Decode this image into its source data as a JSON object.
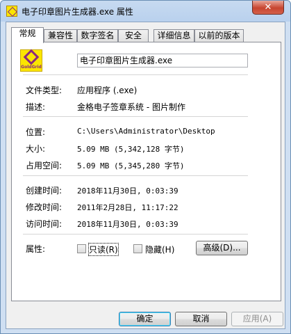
{
  "window": {
    "title": "电子印章图片生成器.exe 属性",
    "close_label": "✕"
  },
  "tabs": [
    {
      "label": "常规"
    },
    {
      "label": "兼容性"
    },
    {
      "label": "数字签名"
    },
    {
      "label": "安全"
    },
    {
      "label": "详细信息"
    },
    {
      "label": "以前的版本"
    }
  ],
  "general": {
    "logo_text": "GoldGrid",
    "file_name": "电子印章图片生成器.exe",
    "file_type_label": "文件类型:",
    "file_type_value": "应用程序 (.exe)",
    "description_label": "描述:",
    "description_value": "金格电子签章系统 - 图片制作",
    "location_label": "位置:",
    "location_value": "C:\\Users\\Administrator\\Desktop",
    "size_label": "大小:",
    "size_value": "5.09 MB (5,342,128 字节)",
    "size_on_disk_label": "占用空间:",
    "size_on_disk_value": "5.09 MB (5,345,280 字节)",
    "created_label": "创建时间:",
    "created_value": "2018年11月30日, 0:03:39",
    "modified_label": "修改时间:",
    "modified_value": "2011年2月28日, 11:17:22",
    "accessed_label": "访问时间:",
    "accessed_value": "2018年11月30日, 0:03:39",
    "attributes_label": "属性:",
    "readonly_label": "只读(R)",
    "hidden_label": "隐藏(H)",
    "advanced_label": "高级(D)..."
  },
  "footer": {
    "ok_label": "确定",
    "cancel_label": "取消",
    "apply_label": "应用(A)"
  }
}
